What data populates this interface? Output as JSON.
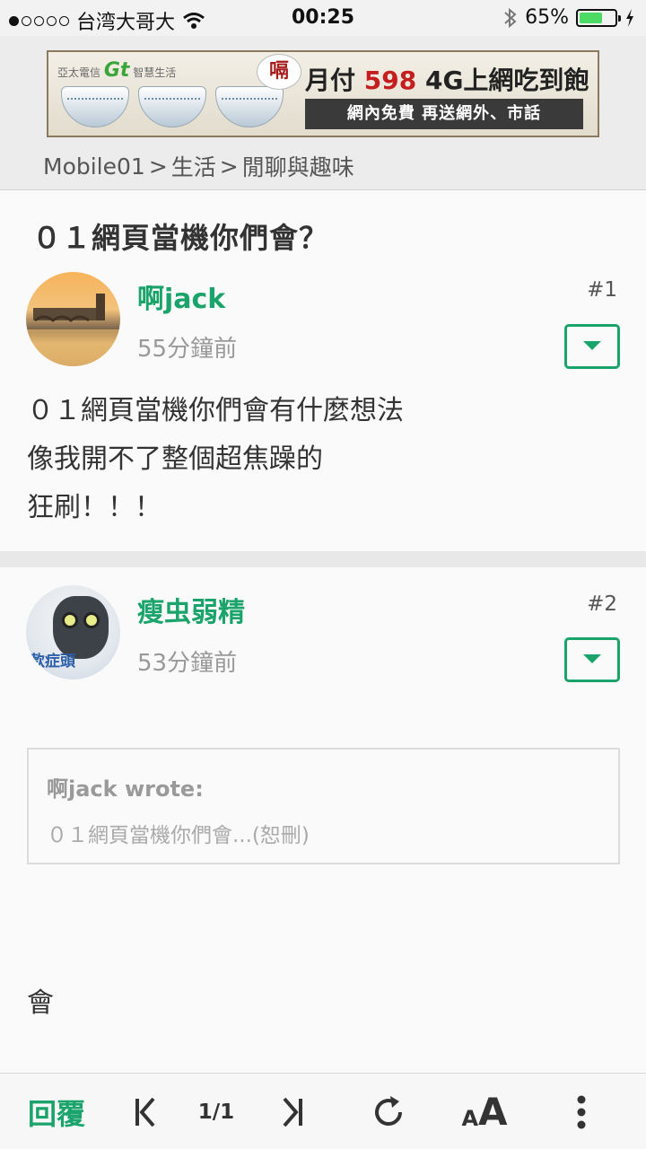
{
  "status_bar": {
    "carrier": "台湾大哥大",
    "time": "00:25",
    "battery": "65%",
    "battery_level": 0.65
  },
  "banner": {
    "brand_small": "亞太電信",
    "brand_logo": "Gt",
    "brand_tag": "智慧生活",
    "bubble": "嗝",
    "promo_prefix": "月付",
    "promo_price": "598",
    "promo_suffix": "4G上網吃到飽",
    "sub_text": "網內免費 再送網外、市話"
  },
  "breadcrumb": {
    "items": [
      "Mobile01",
      "生活",
      "閒聊與趣味"
    ],
    "separator": ">"
  },
  "thread": {
    "title": "０１網頁當機你們會？"
  },
  "posts": [
    {
      "author": "啊jack",
      "time_ago": "55分鐘前",
      "floor": "#1",
      "body": [
        "０１網頁當機你們會有什麼想法",
        "像我開不了整個超焦躁的",
        "狂刷！！！"
      ]
    },
    {
      "author": "瘦虫弱精",
      "time_ago": "53分鐘前",
      "floor": "#2",
      "avatar_text": "款症頭",
      "quote_author": "啊jack wrote:",
      "quote_text": "０１網頁當機你們會...(恕刪)",
      "body": "會"
    }
  ],
  "toolbar": {
    "reply_label": "回覆",
    "page_indicator": "1/1",
    "font_small": "A",
    "font_big": "A"
  },
  "icons": [
    "wifi-icon",
    "bluetooth-icon",
    "charging-icon",
    "dropdown-arrow-icon",
    "first-page-icon",
    "last-page-icon",
    "refresh-icon",
    "more-icon"
  ],
  "colors": {
    "accent": "#1aa36a",
    "battery": "#4cd964"
  }
}
